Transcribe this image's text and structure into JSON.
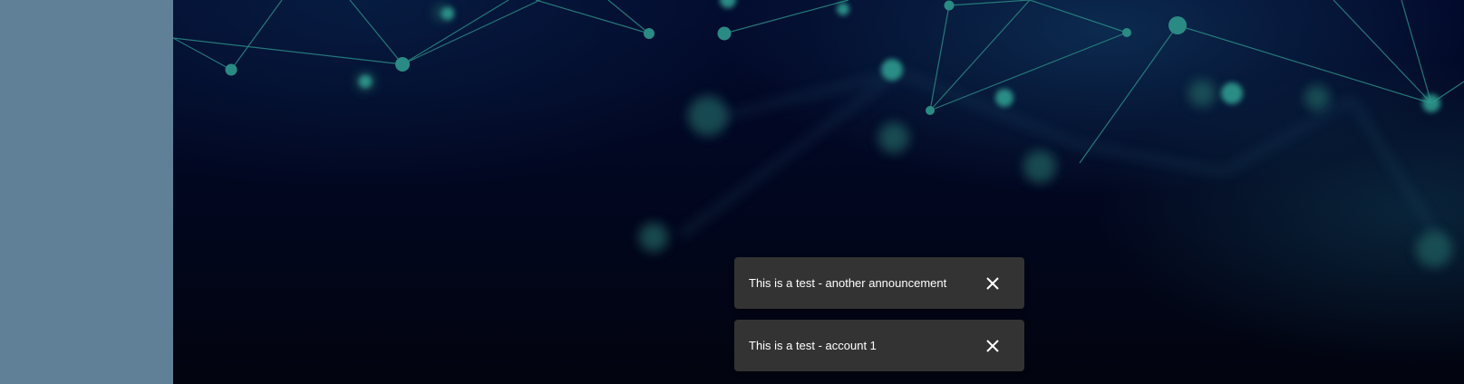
{
  "colors": {
    "sidebar": "#5f8096",
    "hero_background": "#020721",
    "network_accent": "#2a8a84",
    "toast_background": "#333333",
    "toast_text": "#ffffff"
  },
  "toasts": [
    {
      "message": "This is a test - another announcement",
      "close_icon": "close-icon"
    },
    {
      "message": "This is a test - account 1",
      "close_icon": "close-icon"
    }
  ]
}
